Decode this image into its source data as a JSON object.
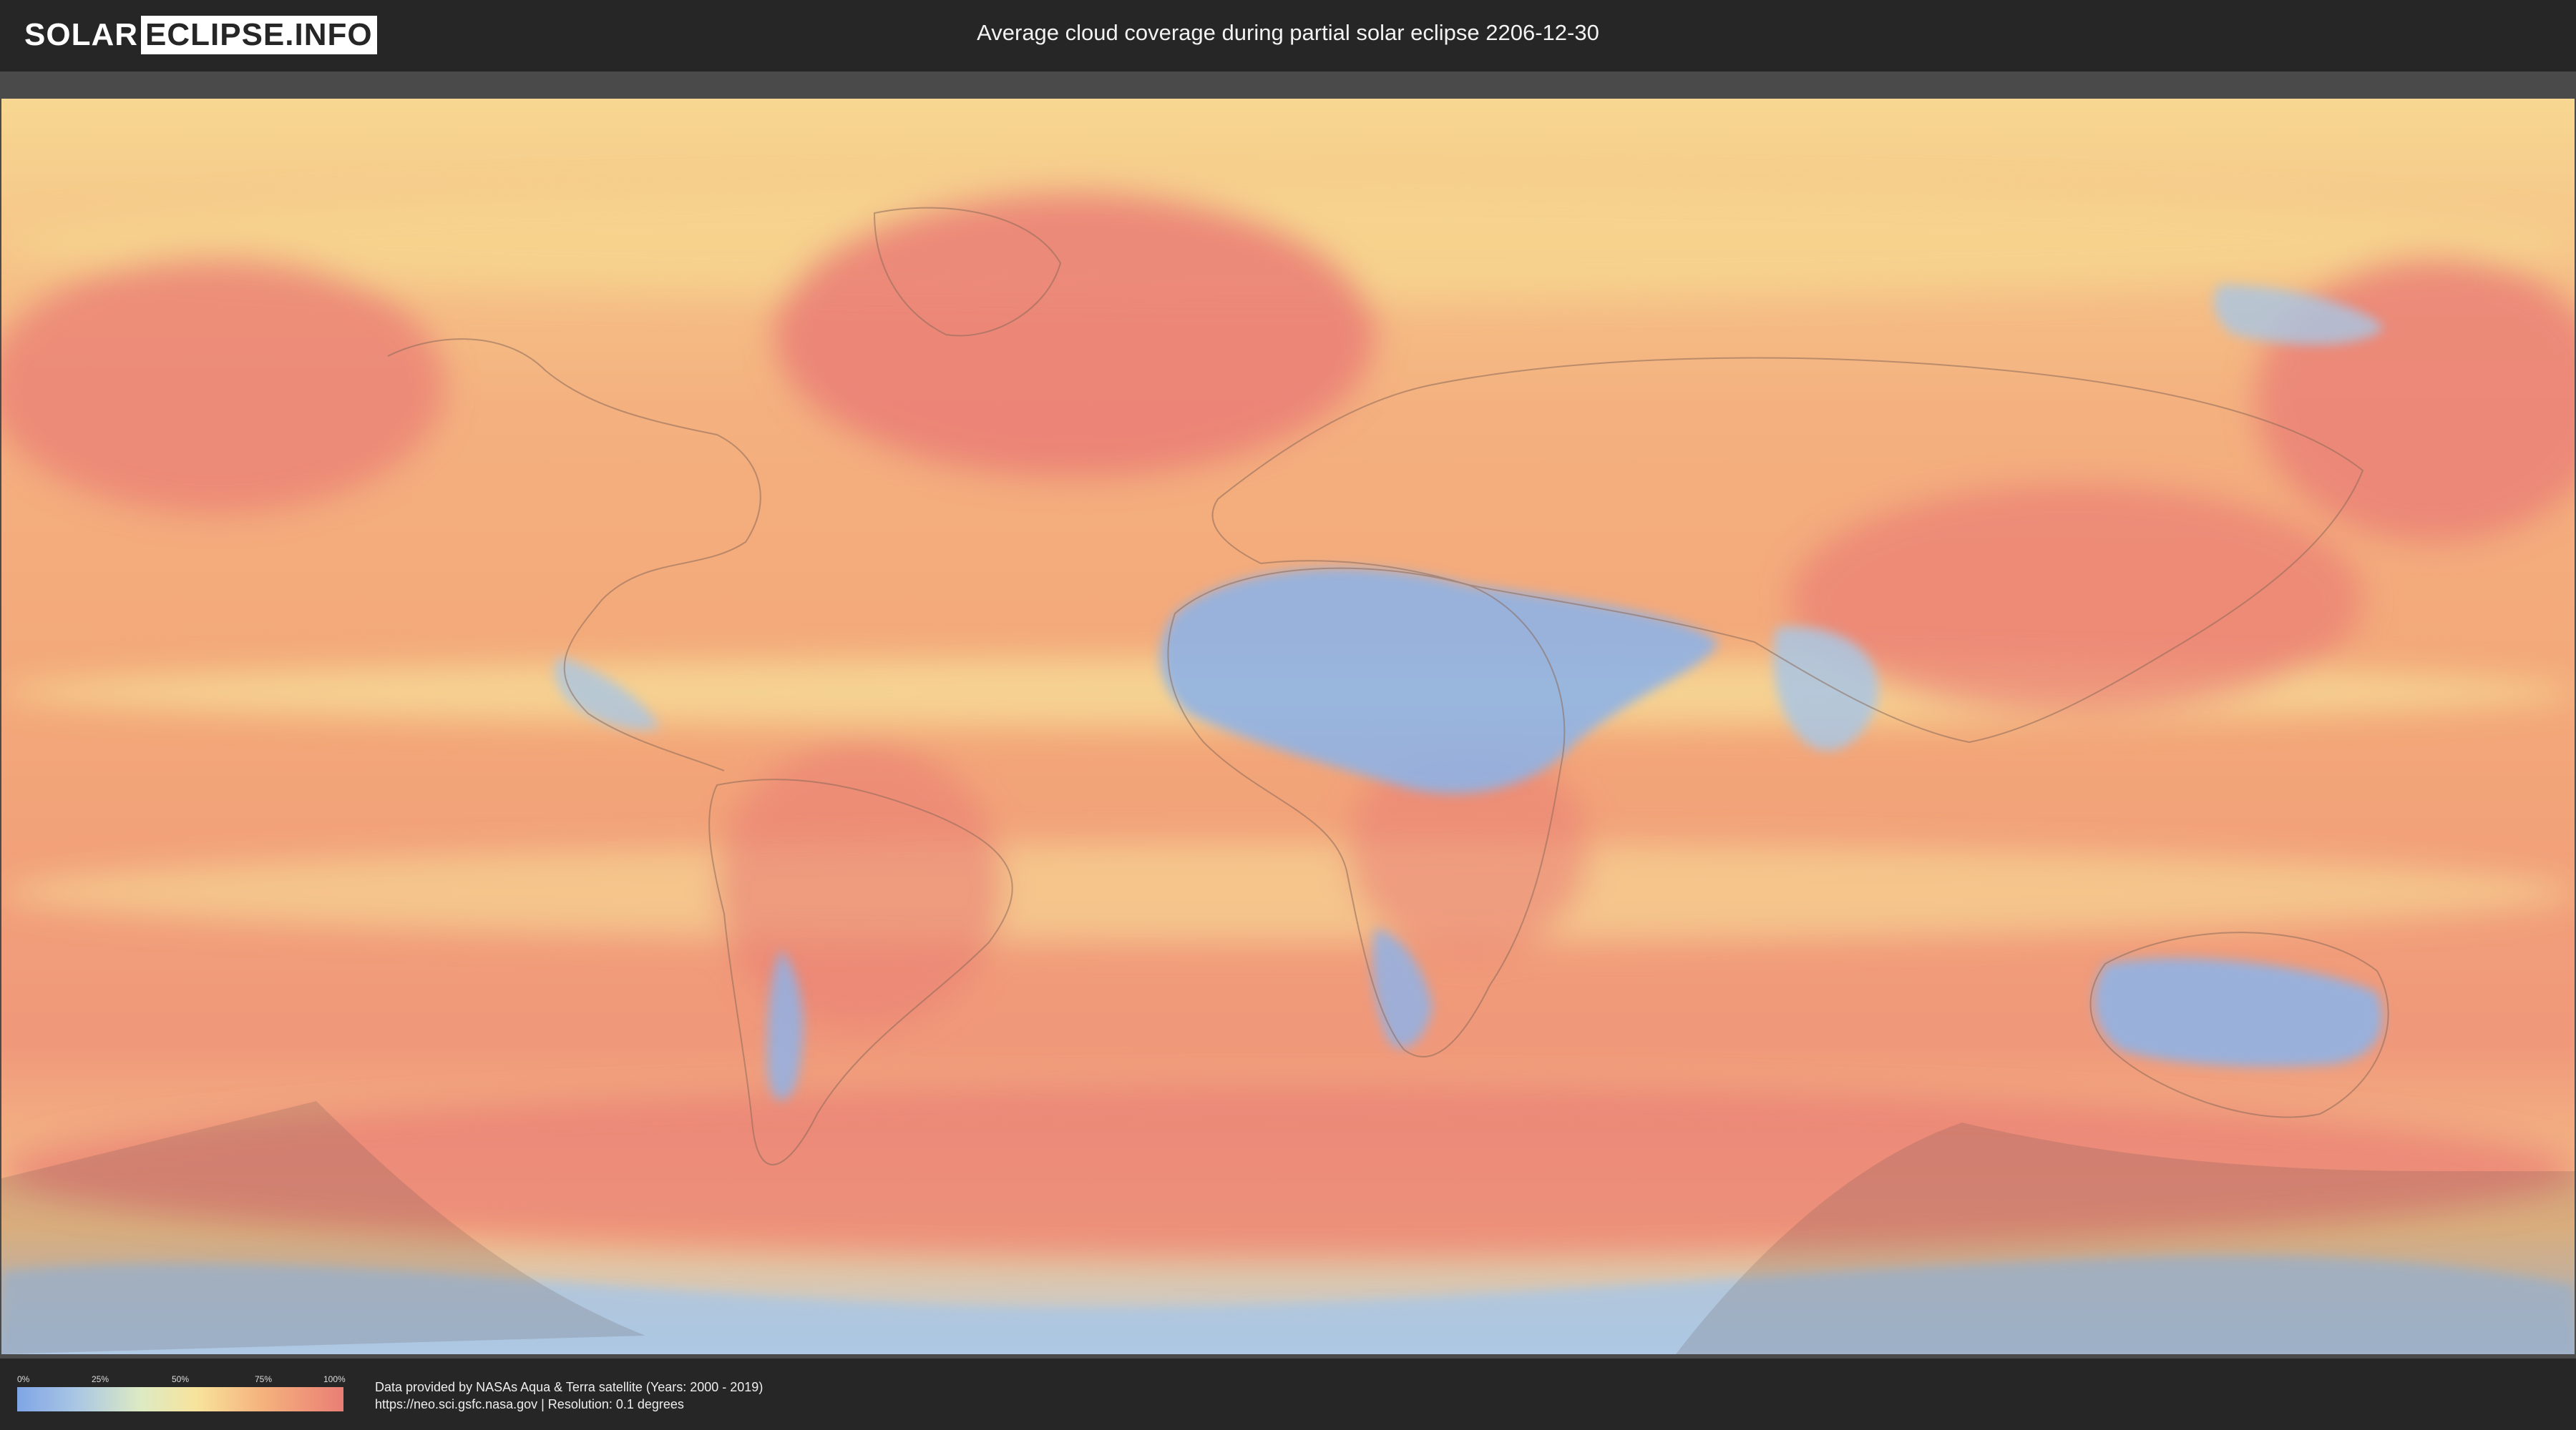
{
  "header": {
    "logo_left": "SOLAR",
    "logo_right": "ECLIPSE.INFO",
    "title": "Average cloud coverage during partial solar eclipse 2206-12-30"
  },
  "legend": {
    "ticks": [
      "0%",
      "25%",
      "50%",
      "75%",
      "100%"
    ],
    "colors": [
      "#7fa5e6",
      "#a9c6e4",
      "#ddeac3",
      "#f7e39b",
      "#f5b27d",
      "#ea7e75"
    ]
  },
  "footer": {
    "credit_line1": "Data provided by NASAs Aqua & Terra satellite (Years: 2000 - 2019)",
    "credit_line2": "https://neo.sci.gsfc.nasa.gov | Resolution: 0.1 degrees"
  },
  "map": {
    "colors": {
      "high_cloud": "#ea7e75",
      "mid_high": "#f5b27d",
      "mid": "#f7e39b",
      "low_mid": "#ddeac3",
      "low": "#8fb2e6",
      "eclipse_shadow": "#5a4a4a"
    }
  }
}
